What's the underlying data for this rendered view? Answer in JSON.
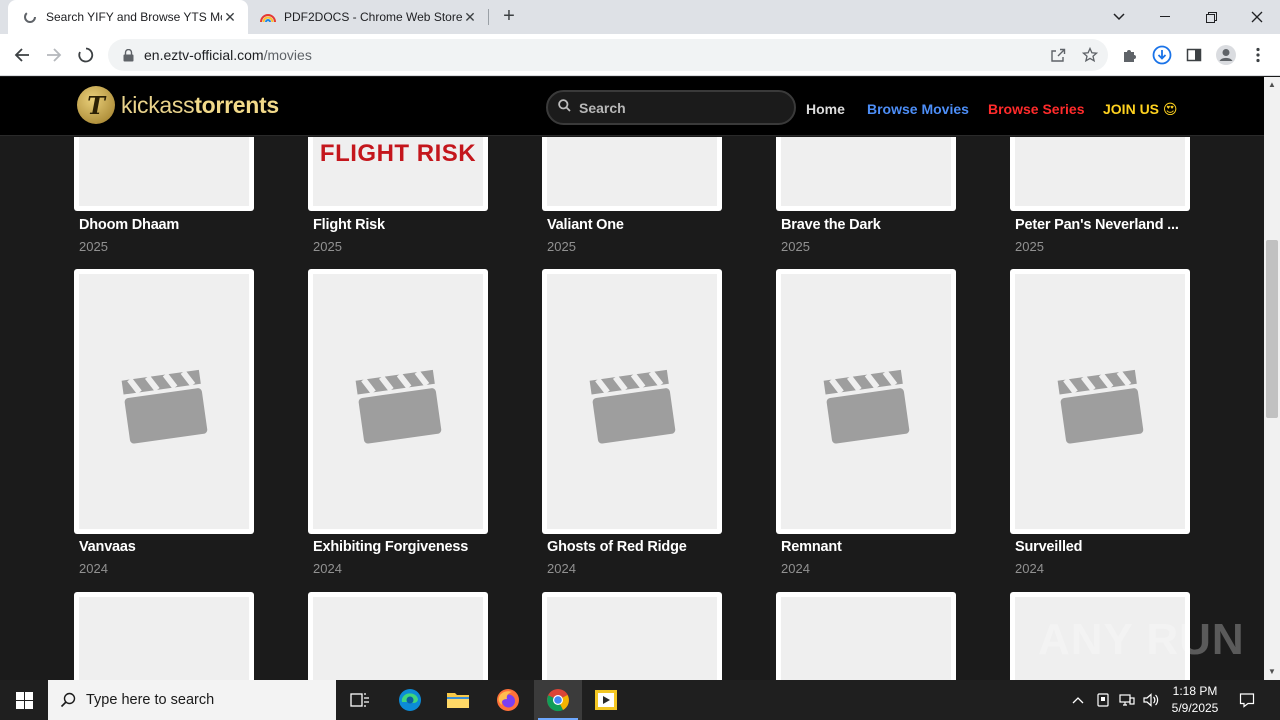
{
  "browser": {
    "tabs": [
      {
        "title": "Search YIFY and Browse YTS Mo",
        "active": true
      },
      {
        "title": "PDF2DOCS - Chrome Web Store",
        "active": false
      }
    ],
    "new_tab_label": "+",
    "url_host": "en.eztv-official.com",
    "url_path": "/movies"
  },
  "site": {
    "logo_letter": "T",
    "logo_text_light": "kickass",
    "logo_text_bold": "torrents",
    "search_placeholder": "Search",
    "nav": {
      "home": "Home",
      "browse_movies": "Browse Movies",
      "browse_series": "Browse Series",
      "join": "JOIN US 😍"
    },
    "colors": {
      "browse_movies": "#4d8ef7",
      "browse_series": "#ff2b2b",
      "join": "#ffd21f",
      "logo_gold": "#e9d38c"
    }
  },
  "movies": [
    {
      "title": "Dhoom Dhaam",
      "year": "2025",
      "poster_text": ""
    },
    {
      "title": "Flight Risk",
      "year": "2025",
      "poster_text": "FLIGHT RISK"
    },
    {
      "title": "Valiant One",
      "year": "2025",
      "poster_text": ""
    },
    {
      "title": "Brave the Dark",
      "year": "2025",
      "poster_text": ""
    },
    {
      "title": "Peter Pan's Neverland ...",
      "year": "2025",
      "poster_text": ""
    },
    {
      "title": "Vanvaas",
      "year": "2024",
      "poster_text": ""
    },
    {
      "title": "Exhibiting Forgiveness",
      "year": "2024",
      "poster_text": ""
    },
    {
      "title": "Ghosts of Red Ridge",
      "year": "2024",
      "poster_text": ""
    },
    {
      "title": "Remnant",
      "year": "2024",
      "poster_text": ""
    },
    {
      "title": "Surveilled",
      "year": "2024",
      "poster_text": ""
    }
  ],
  "watermark": "ANY RUN",
  "taskbar": {
    "search_placeholder": "Type here to search",
    "time": "1:18 PM",
    "date": "5/9/2025"
  }
}
